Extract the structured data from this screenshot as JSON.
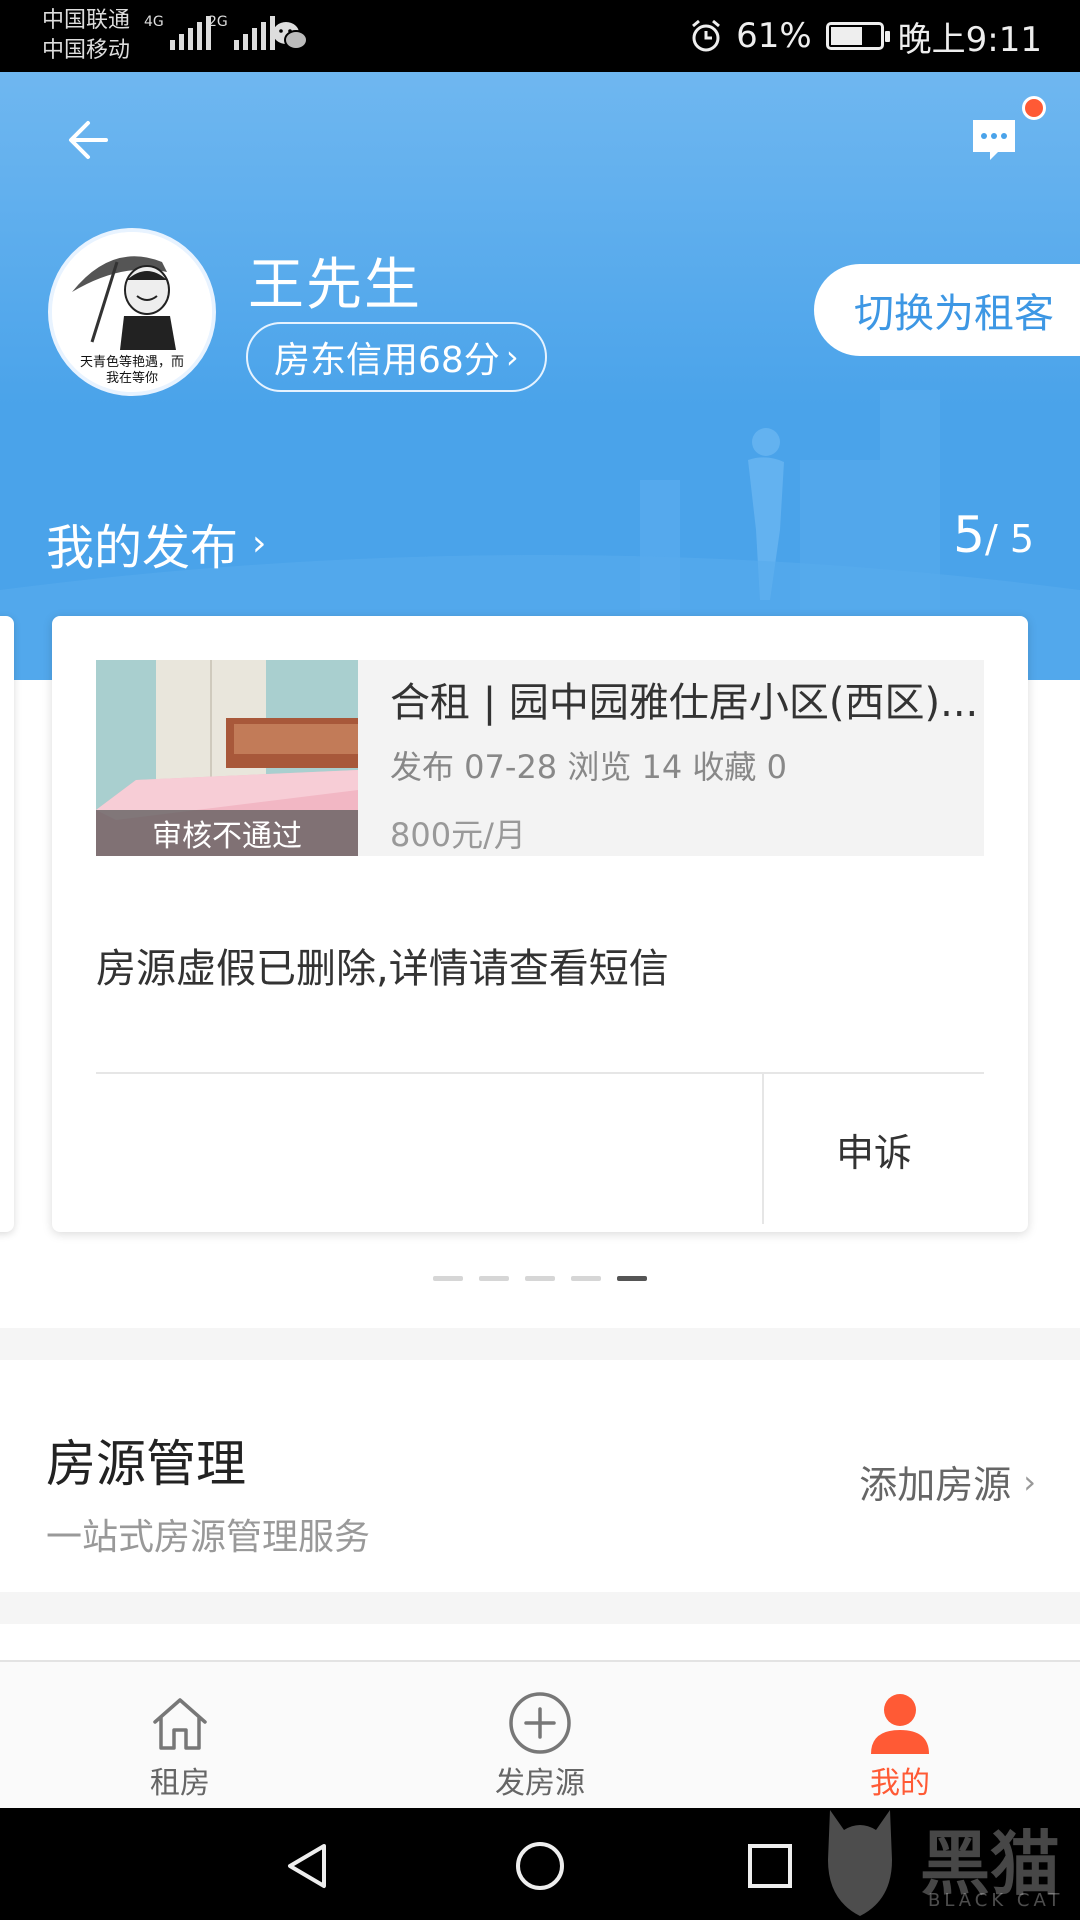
{
  "status_bar": {
    "carrier_1": "中国联通",
    "carrier_2": "中国移动",
    "net_1": "4G",
    "net_2": "2G",
    "battery": "61%",
    "time": "晚上9:11",
    "icons": [
      "signal-icon",
      "wechat-icon",
      "alarm-icon",
      "battery-icon"
    ]
  },
  "header": {
    "back_icon": "back-arrow-icon",
    "message_icon": "message-icon",
    "user_name": "王先生",
    "avatar_caption_1": "天青色等艳遇，而",
    "avatar_caption_2": "我在等你",
    "credit": "房东信用68分",
    "switch_role": "切换为租客"
  },
  "publications": {
    "title": "我的发布",
    "current": "5",
    "total": "/ 5",
    "card": {
      "status": "审核不通过",
      "title": "合租 | 园中园雅仕居小区(西区)...",
      "stats": "发布 07-28 浏览 14 收藏 0",
      "price": "800元/月",
      "note": "房源虚假已删除,详情请查看短信",
      "appeal": "申诉"
    },
    "page_count": 5,
    "active_page": 5
  },
  "management": {
    "title": "房源管理",
    "subtitle": "一站式房源管理服务",
    "add_link": "添加房源"
  },
  "tabbar": {
    "tabs": [
      {
        "label": "租房",
        "icon": "house-icon",
        "active": false
      },
      {
        "label": "发房源",
        "icon": "plus-circle-icon",
        "active": false
      },
      {
        "label": "我的",
        "icon": "user-icon",
        "active": true
      }
    ]
  },
  "watermark": {
    "text": "黑猫",
    "sub": "BLACK CAT"
  },
  "colors": {
    "header_blue": "#4aa3ea",
    "accent_orange": "#ff5a35",
    "switch_text_blue": "#3d97e4"
  }
}
